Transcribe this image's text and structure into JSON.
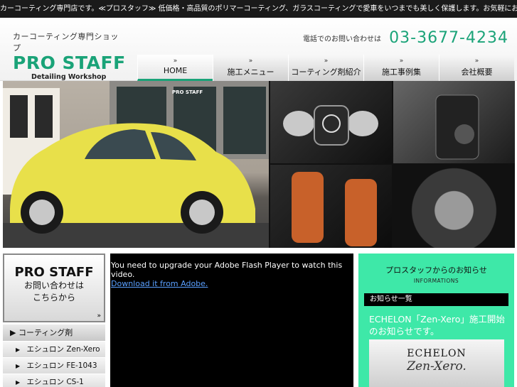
{
  "topbar": {
    "text": "カーコーティング専門店です。≪プロスタッフ≫ 低価格・高品質のポリマーコーティング、ガラスコーティングで愛車をいつまでも美しく保護します。お気軽にお問い合わせください。"
  },
  "header": {
    "tagline": "カーコーティング専門ショップ",
    "brand": "PRO STAFF",
    "subtitle": "Detailing Workshop",
    "phone_label": "電話でのお問い合わせは",
    "phone_number": "03-3677-4234",
    "accent_color": "#1aa378"
  },
  "nav": {
    "items": [
      {
        "label": "HOME",
        "icon": "double-chevron-right-icon"
      },
      {
        "label": "施工メニュー"
      },
      {
        "label": "コーティング剤紹介"
      },
      {
        "label": "施工事例集"
      },
      {
        "label": "会社概要"
      }
    ]
  },
  "hero": {
    "sign": "PRO STAFF"
  },
  "sidebar": {
    "contact_brand": "PRO STAFF",
    "contact_line1": "お問い合わせは",
    "contact_line2": "こちらから",
    "section_title": "コーティング剤",
    "items": [
      {
        "label": "エシュロン Zen-Xero"
      },
      {
        "label": "エシュロン FE-1043"
      },
      {
        "label": "エシュロン CS-1"
      }
    ]
  },
  "flash": {
    "message": "You need to upgrade your Adobe Flash Player to watch this video.",
    "link": "Download it from Adobe."
  },
  "info": {
    "title": "プロスタッフからのお知らせ",
    "subtitle": "INFORMATIONS",
    "bar_label": "お知らせ一覧",
    "news": "ECHELON「Zen-Xero」施工開始のお知らせです。",
    "banner_brand": "ECHELON",
    "banner_product": "Zen-Xero."
  }
}
